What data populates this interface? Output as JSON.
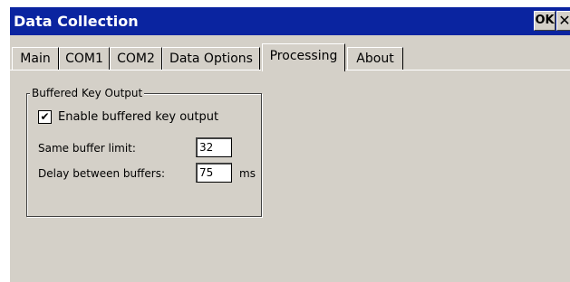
{
  "window": {
    "title": "Data Collection"
  },
  "titlebar": {
    "ok_label": "OK",
    "close_label": "✕"
  },
  "tabs": [
    {
      "label": "Main"
    },
    {
      "label": "COM1"
    },
    {
      "label": "COM2"
    },
    {
      "label": "Data Options"
    },
    {
      "label": "Processing",
      "active": true
    },
    {
      "label": "About"
    }
  ],
  "group": {
    "title": "Buffered Key Output",
    "checkbox": {
      "label": "Enable buffered key output",
      "checked": true,
      "mark": "✔"
    },
    "same_buffer_limit": {
      "label": "Same buffer limit:",
      "value": "32"
    },
    "delay_between_buffers": {
      "label": "Delay between buffers:",
      "value": "75",
      "unit": "ms"
    }
  }
}
